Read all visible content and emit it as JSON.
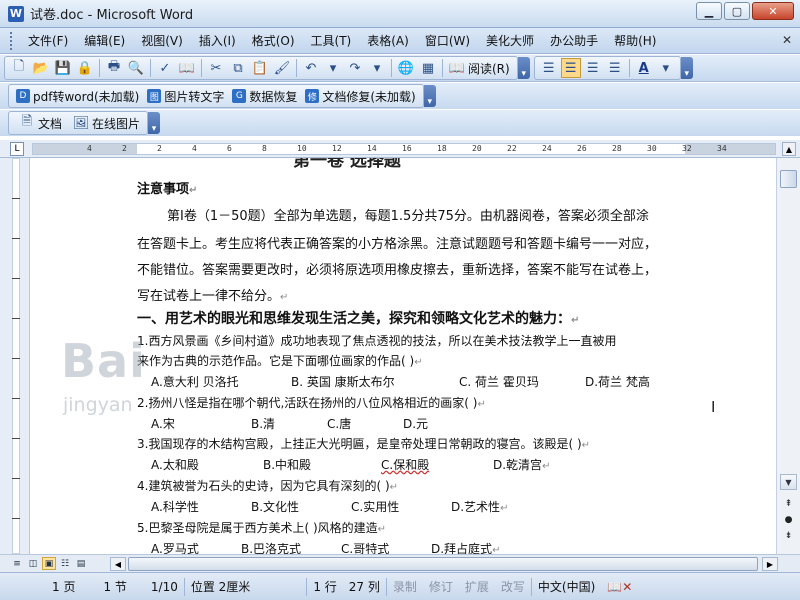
{
  "window": {
    "title": "试卷.doc - Microsoft Word",
    "app_icon": "W"
  },
  "menu": [
    "文件(F)",
    "编辑(E)",
    "视图(V)",
    "插入(I)",
    "格式(O)",
    "工具(T)",
    "表格(A)",
    "窗口(W)",
    "美化大师",
    "办公助手",
    "帮助(H)"
  ],
  "toolbar": {
    "reading_label": "阅读(R)"
  },
  "plugins": [
    {
      "label": "pdf转word(未加载)"
    },
    {
      "label": "图片转文字"
    },
    {
      "label": "数据恢复"
    },
    {
      "label": "文档修复(未加载)"
    }
  ],
  "toolbar3": {
    "doc_label": "文档",
    "online_images_label": "在线图片"
  },
  "ruler": {
    "box_label": "L",
    "ticks": [
      "4",
      "2",
      "2",
      "4",
      "6",
      "8",
      "10",
      "12",
      "14",
      "16",
      "18",
      "20",
      "22",
      "24",
      "26",
      "28",
      "30",
      "32",
      "34"
    ]
  },
  "document": {
    "cut_title": "第一卷 选择题",
    "notes_heading": "注意事项",
    "notes_lines": [
      "第Ⅰ卷（1－50题）全部为单选题，每题1.5分共75分。由机器阅卷，答案必须全部涂",
      "在答题卡上。考生应将代表正确答案的小方格涂黑。注意试题题号和答题卡编号一一对应，",
      "不能错位。答案需要更改时，必须将原选项用橡皮擦去，重新选择，答案不能写在试卷上，",
      "写在试卷上一律不给分。"
    ],
    "section_heading": "一、用艺术的眼光和思维发现生活之美，探究和领略文化艺术的魅力：",
    "questions": [
      {
        "lines": [
          "1.西方风景画《乡间村道》成功地表现了焦点透视的技法，所以在美术技法教学上一直被用",
          "来作为古典的示范作品。它是下面哪位画家的作品(        )"
        ],
        "options": [
          "A.意大利  贝洛托",
          "B. 英国    康斯太布尔",
          "C. 荷兰  霍贝玛",
          "D.荷兰     梵高"
        ]
      },
      {
        "lines": [
          "2.扬州八怪是指在哪个朝代,活跃在扬州的八位风格相近的画家(        )"
        ],
        "options": [
          "A.宋",
          "B.清",
          "C.唐",
          "D.元"
        ]
      },
      {
        "lines": [
          "3.我国现存的木结构宫殿，上挂正大光明匾，是皇帝处理日常朝政的寝宫。该殿是(         )"
        ],
        "options": [
          "A.太和殿",
          "B.中和殿",
          "C.保和殿",
          "D.乾清宫"
        ]
      },
      {
        "lines": [
          "4.建筑被誉为石头的史诗，因为它具有深刻的(        )"
        ],
        "options": [
          "A.科学性",
          "B.文化性",
          "C.实用性",
          "D.艺术性"
        ]
      },
      {
        "lines": [
          "5.巴黎圣母院是属于西方美术上(        )风格的建造"
        ],
        "options": [
          "A.罗马式",
          "B.巴洛克式",
          "C.哥特式",
          "D.拜占庭式"
        ]
      }
    ]
  },
  "watermark": {
    "text": "Bai",
    "sub": "jingyan"
  },
  "status": {
    "page": "1 页",
    "section": "1 节",
    "pages": "1/10",
    "position": "位置 2厘米",
    "line": "1 行",
    "column": "27 列",
    "rec": "录制",
    "trk": "修订",
    "ext": "扩展",
    "ovr": "改写",
    "language": "中文(中国)"
  },
  "colors": {
    "accent": "#3f66a8",
    "toolbar": "#c7d9ef",
    "spell": "#d03030"
  }
}
